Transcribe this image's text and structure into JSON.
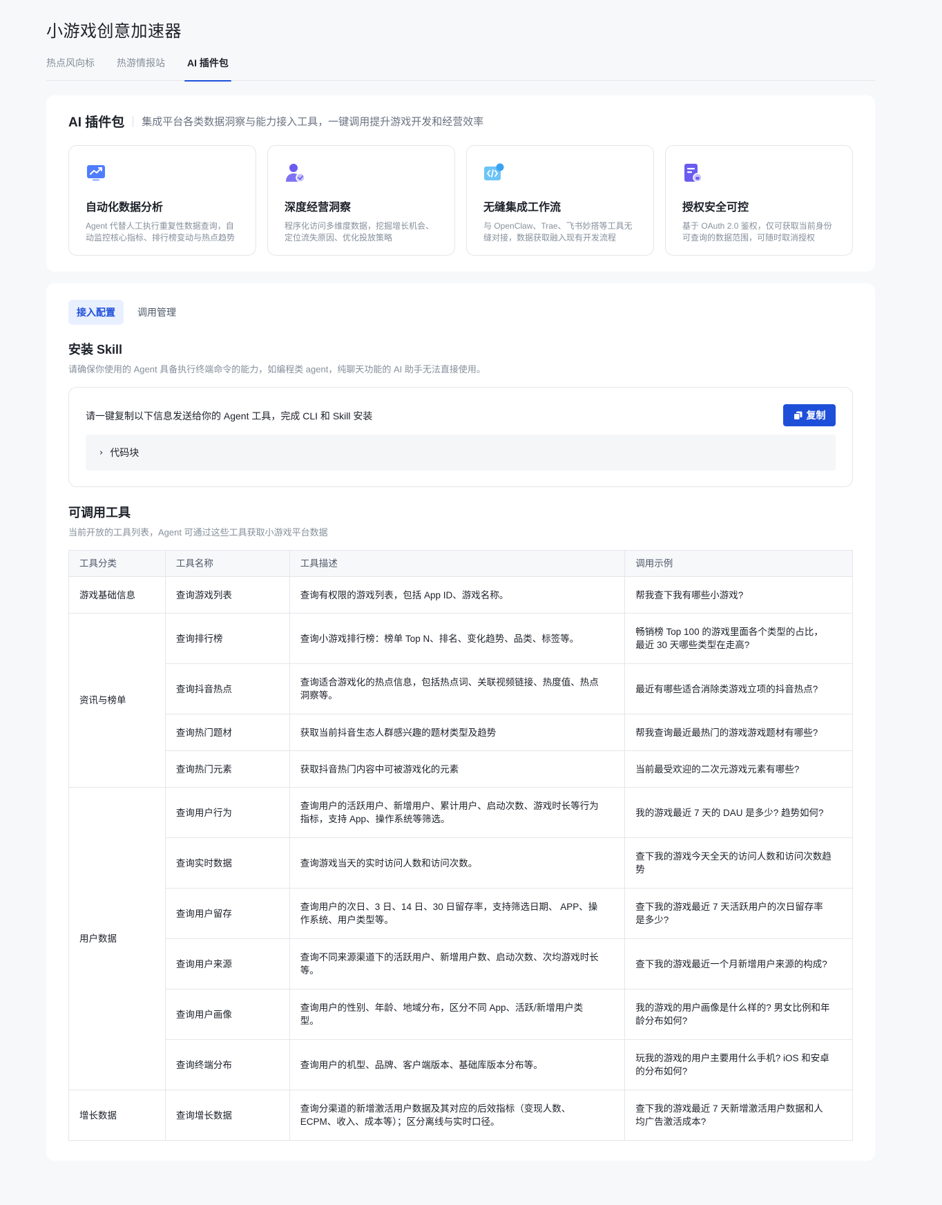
{
  "app": {
    "title": "小游戏创意加速器"
  },
  "top_tabs": [
    {
      "label": "热点风向标"
    },
    {
      "label": "热游情报站"
    },
    {
      "label": "AI 插件包"
    }
  ],
  "intro": {
    "title": "AI 插件包",
    "description": "集成平台各类数据洞察与能力接入工具，一键调用提升游戏开发和经营效率",
    "features": [
      {
        "title": "自动化数据分析",
        "desc_line1": "Agent 代替人工执行重复性数据查询，自",
        "desc_line2": "动监控核心指标、排行榜变动与热点趋势",
        "icon": "chart-screen-icon"
      },
      {
        "title": "深度经营洞察",
        "desc_line1": "程序化访问多维度数据，挖掘增长机会、",
        "desc_line2": "定位流失原因、优化投放策略",
        "icon": "user-insight-icon"
      },
      {
        "title": "无缝集成工作流",
        "desc_line1": "与 OpenClaw、Trae、飞书妙搭等工具无",
        "desc_line2": "缝对接，数据获取融入现有开发流程",
        "icon": "code-integration-icon"
      },
      {
        "title": "授权安全可控",
        "desc_line1": "基于 OAuth 2.0 鉴权，仅可获取当前身份",
        "desc_line2": "可查询的数据范围，可随时取消授权",
        "icon": "auth-document-icon"
      }
    ]
  },
  "config": {
    "tabs": [
      {
        "label": "接入配置"
      },
      {
        "label": "调用管理"
      }
    ],
    "install": {
      "title": "安装 Skill",
      "description": "请确保你使用的 Agent 具备执行终端命令的能力，如编程类 agent，纯聊天功能的 AI 助手无法直接使用。",
      "instruction": "请一键复制以下信息发送给你的 Agent 工具，完成 CLI 和 Skill 安装",
      "copy_label": "复制",
      "code_block_label": "代码块"
    },
    "tools": {
      "title": "可调用工具",
      "description": "当前开放的工具列表，Agent 可通过这些工具获取小游戏平台数据",
      "headers": [
        "工具分类",
        "工具名称",
        "工具描述",
        "调用示例"
      ],
      "categories": [
        "游戏基础信息",
        "资讯与榜单",
        "用户数据",
        "增长数据"
      ],
      "rows": [
        {
          "name": "查询游戏列表",
          "desc": "查询有权限的游戏列表，包括 App ID、游戏名称。",
          "example": "帮我查下我有哪些小游戏?"
        },
        {
          "name": "查询排行榜",
          "desc": "查询小游戏排行榜：榜单 Top N、排名、变化趋势、品类、标签等。",
          "example_line1": "畅销榜 Top 100 的游戏里面各个类型的占比，",
          "example_line2": "最近 30 天哪些类型在走高?"
        },
        {
          "name": "查询抖音热点",
          "desc_line1": "查询适合游戏化的热点信息，包括热点词、关联视频链接、热度值、热点",
          "desc_line2": "洞察等。",
          "example": "最近有哪些适合消除类游戏立项的抖音热点?"
        },
        {
          "name": "查询热门题材",
          "desc": "获取当前抖音生态人群感兴趣的题材类型及趋势",
          "example": "帮我查询最近最热门的游戏游戏题材有哪些?"
        },
        {
          "name": "查询热门元素",
          "desc": "获取抖音热门内容中可被游戏化的元素",
          "example": "当前最受欢迎的二次元游戏元素有哪些?"
        },
        {
          "name": "查询用户行为",
          "desc_line1": "查询用户的活跃用户、新增用户、累计用户、启动次数、游戏时长等行为",
          "desc_line2": "指标，支持 App、操作系统等筛选。",
          "example": "我的游戏最近 7 天的 DAU 是多少? 趋势如何?"
        },
        {
          "name": "查询实时数据",
          "desc": "查询游戏当天的实时访问人数和访问次数。",
          "example_line1": "查下我的游戏今天全天的访问人数和访问次数趋",
          "example_line2": "势"
        },
        {
          "name": "查询用户留存",
          "desc_line1": "查询用户的次日、3 日、14 日、30 日留存率，支持筛选日期、 APP、操",
          "desc_line2": "作系统、用户类型等。",
          "example_line1": "查下我的游戏最近 7 天活跃用户的次日留存率",
          "example_line2": "是多少?"
        },
        {
          "name": "查询用户来源",
          "desc_line1": "查询不同来源渠道下的活跃用户、新增用户数、启动次数、次均游戏时长",
          "desc_line2": "等。",
          "example": "查下我的游戏最近一个月新增用户来源的构成?"
        },
        {
          "name": "查询用户画像",
          "desc_line1": "查询用户的性别、年龄、地域分布，区分不同 App、活跃/新增用户类",
          "desc_line2": "型。",
          "example_line1": "我的游戏的用户画像是什么样的? 男女比例和年",
          "example_line2": "龄分布如何?"
        },
        {
          "name": "查询终端分布",
          "desc": "查询用户的机型、品牌、客户端版本、基础库版本分布等。",
          "example_line1": "玩我的游戏的用户主要用什么手机? iOS 和安卓",
          "example_line2": "的分布如何?"
        },
        {
          "name": "查询增长数据",
          "desc_line1": "查询分渠道的新增激活用户数据及其对应的后效指标（变现人数、",
          "desc_line2": "ECPM、收入、成本等）；区分离线与实时口径。",
          "example_line1": "查下我的游戏最近 7 天新增激活用户数据和人",
          "example_line2": "均广告激活成本?"
        }
      ]
    }
  },
  "colors": {
    "accent": "#1e4fd9",
    "background": "#f7f8fa"
  }
}
